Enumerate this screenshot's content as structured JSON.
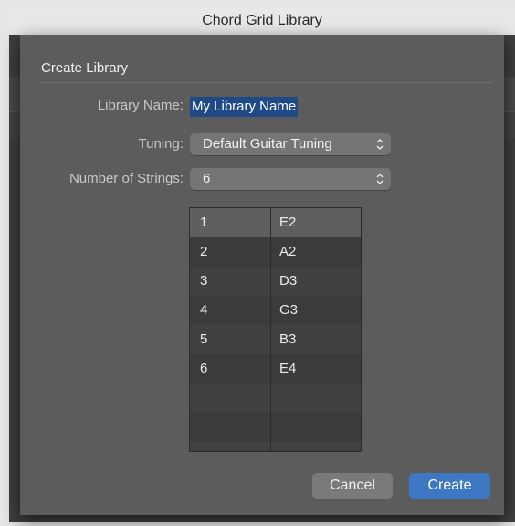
{
  "window": {
    "title": "Chord Grid Library"
  },
  "sheet": {
    "title": "Create Library"
  },
  "form": {
    "name_label": "Library Name:",
    "name_value": "My Library Name",
    "tuning_label": "Tuning:",
    "tuning_value": "Default Guitar Tuning",
    "strings_label": "Number of Strings:",
    "strings_value": "6"
  },
  "table": {
    "rows": [
      {
        "string": "1",
        "note": "E2"
      },
      {
        "string": "2",
        "note": "A2"
      },
      {
        "string": "3",
        "note": "D3"
      },
      {
        "string": "4",
        "note": "G3"
      },
      {
        "string": "5",
        "note": "B3"
      },
      {
        "string": "6",
        "note": "E4"
      }
    ]
  },
  "buttons": {
    "cancel": "Cancel",
    "create": "Create"
  },
  "colors": {
    "accent": "#3e78c4",
    "selection": "#204a87",
    "sheet": "#5c5c5c"
  },
  "icons": {
    "popup_arrows": "up-down-chevron-icon"
  }
}
